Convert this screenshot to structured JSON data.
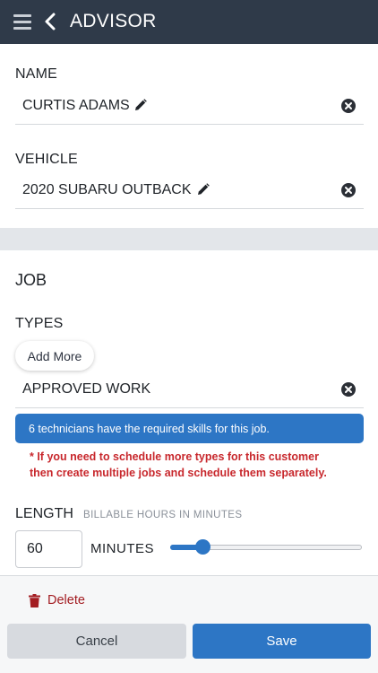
{
  "header": {
    "title": "ADVISOR",
    "menu_icon": "hamburger-icon",
    "back_icon": "chevron-left-icon"
  },
  "name": {
    "label": "NAME",
    "value": "CURTIS ADAMS"
  },
  "vehicle": {
    "label": "VEHICLE",
    "value": "2020 SUBARU OUTBACK"
  },
  "job": {
    "title": "JOB",
    "types_label": "TYPES",
    "add_more_label": "Add More",
    "type_value": "APPROVED WORK",
    "info_message": "6 technicians have the required skills for this job.",
    "warning_line1": "* If you need to schedule more types for this customer",
    "warning_line2": "then create multiple jobs and schedule them separately.",
    "length_label": "LENGTH",
    "length_hint": "BILLABLE HOURS IN MINUTES",
    "minutes_value": "60",
    "minutes_unit": "MINUTES",
    "slider_fraction": 0.14
  },
  "footer": {
    "delete_label": "Delete",
    "cancel_label": "Cancel",
    "save_label": "Save"
  },
  "colors": {
    "header_bg": "#2f3a49",
    "accent": "#2d76c5",
    "danger": "#c8282d"
  }
}
